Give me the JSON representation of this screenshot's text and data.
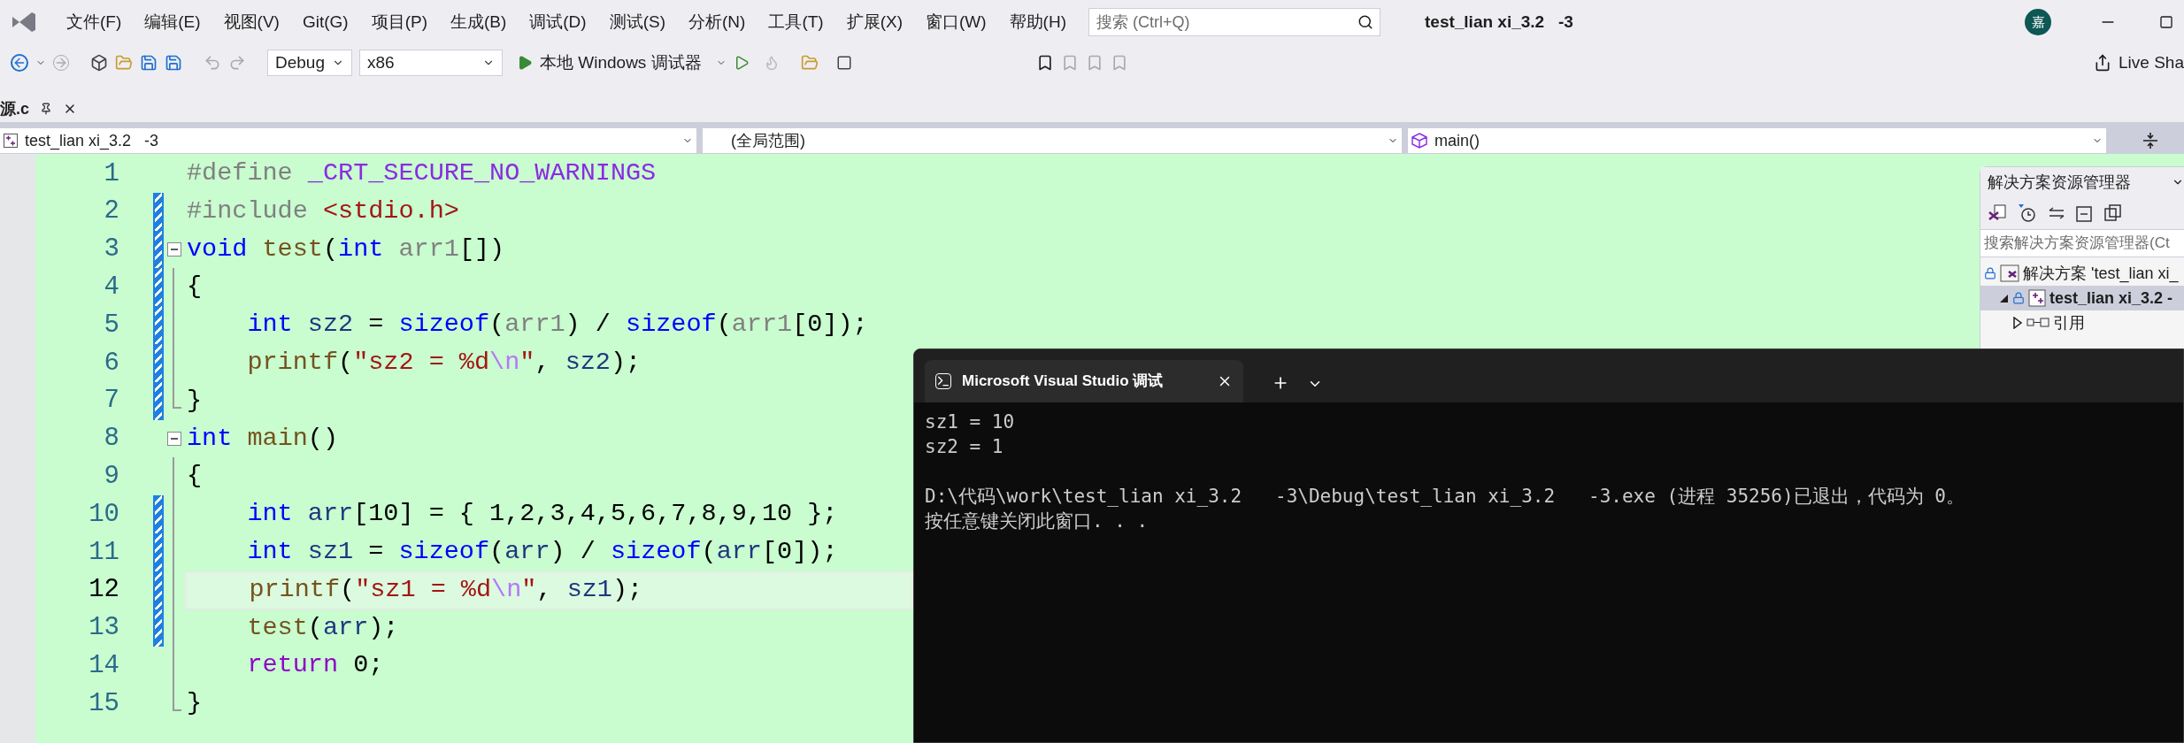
{
  "menu": [
    "文件(F)",
    "编辑(E)",
    "视图(V)",
    "Git(G)",
    "项目(P)",
    "生成(B)",
    "调试(D)",
    "测试(S)",
    "分析(N)",
    "工具(T)",
    "扩展(X)",
    "窗口(W)",
    "帮助(H)"
  ],
  "search": {
    "placeholder": "搜索 (Ctrl+Q)"
  },
  "window": {
    "title": "test_lian xi_3.2   -3",
    "avatar": "嘉"
  },
  "toolbar": {
    "configuration": "Debug",
    "platform": "x86",
    "run": "本地 Windows 调试器",
    "live_share": "Live Sha"
  },
  "document_tab": {
    "title": "源.c",
    "selected": true
  },
  "navigation": {
    "project": "test_lian xi_3.2   -3",
    "scope": "(全局范围)",
    "member": "main()"
  },
  "code": [
    {
      "number": "1",
      "changed": false,
      "current": false,
      "fold": false,
      "in_block": false,
      "block_end": false,
      "tokens": [
        {
          "kind": "pp",
          "text": "#define "
        },
        {
          "kind": "macro",
          "text": "_CRT_SECURE_NO_WARNINGS"
        }
      ]
    },
    {
      "number": "2",
      "changed": true,
      "current": false,
      "fold": false,
      "in_block": false,
      "block_end": false,
      "tokens": [
        {
          "kind": "pp",
          "text": "#include "
        },
        {
          "kind": "str",
          "text": "<stdio.h>"
        }
      ]
    },
    {
      "number": "3",
      "changed": true,
      "current": false,
      "fold": true,
      "in_block": false,
      "block_end": false,
      "tokens": [
        {
          "kind": "kw",
          "text": "void "
        },
        {
          "kind": "fn",
          "text": "test"
        },
        {
          "kind": "plain",
          "text": "("
        },
        {
          "kind": "kw",
          "text": "int "
        },
        {
          "kind": "param",
          "text": "arr1"
        },
        {
          "kind": "plain",
          "text": "[])"
        }
      ]
    },
    {
      "number": "4",
      "changed": true,
      "current": false,
      "fold": false,
      "in_block": true,
      "block_end": false,
      "tokens": [
        {
          "kind": "plain",
          "text": "{"
        }
      ]
    },
    {
      "number": "5",
      "changed": true,
      "current": false,
      "fold": false,
      "in_block": true,
      "block_end": false,
      "tokens": [
        {
          "kind": "kw",
          "text": "    int "
        },
        {
          "kind": "var",
          "text": "sz2"
        },
        {
          "kind": "plain",
          "text": " = "
        },
        {
          "kind": "kw",
          "text": "sizeof"
        },
        {
          "kind": "plain",
          "text": "("
        },
        {
          "kind": "param",
          "text": "arr1"
        },
        {
          "kind": "plain",
          "text": ") / "
        },
        {
          "kind": "kw",
          "text": "sizeof"
        },
        {
          "kind": "plain",
          "text": "("
        },
        {
          "kind": "param",
          "text": "arr1"
        },
        {
          "kind": "plain",
          "text": "[0]);"
        }
      ]
    },
    {
      "number": "6",
      "changed": true,
      "current": false,
      "fold": false,
      "in_block": true,
      "block_end": false,
      "tokens": [
        {
          "kind": "fn",
          "text": "    printf"
        },
        {
          "kind": "plain",
          "text": "("
        },
        {
          "kind": "str",
          "text": "\"sz2 = %d"
        },
        {
          "kind": "esc",
          "text": "\\n"
        },
        {
          "kind": "str",
          "text": "\""
        },
        {
          "kind": "plain",
          "text": ", "
        },
        {
          "kind": "var",
          "text": "sz2"
        },
        {
          "kind": "plain",
          "text": ");"
        }
      ]
    },
    {
      "number": "7",
      "changed": true,
      "current": false,
      "fold": false,
      "in_block": true,
      "block_end": true,
      "tokens": [
        {
          "kind": "plain",
          "text": "}"
        }
      ]
    },
    {
      "number": "8",
      "changed": false,
      "current": false,
      "fold": true,
      "in_block": false,
      "block_end": false,
      "tokens": [
        {
          "kind": "kw",
          "text": "int "
        },
        {
          "kind": "fn",
          "text": "main"
        },
        {
          "kind": "plain",
          "text": "()"
        }
      ]
    },
    {
      "number": "9",
      "changed": false,
      "current": false,
      "fold": false,
      "in_block": true,
      "block_end": false,
      "tokens": [
        {
          "kind": "plain",
          "text": "{"
        }
      ]
    },
    {
      "number": "10",
      "changed": true,
      "current": false,
      "fold": false,
      "in_block": true,
      "block_end": false,
      "tokens": [
        {
          "kind": "kw",
          "text": "    int "
        },
        {
          "kind": "var",
          "text": "arr"
        },
        {
          "kind": "plain",
          "text": "[10] = { 1,2,3,4,5,6,7,8,9,10 };"
        }
      ]
    },
    {
      "number": "11",
      "changed": true,
      "current": false,
      "fold": false,
      "in_block": true,
      "block_end": false,
      "tokens": [
        {
          "kind": "kw",
          "text": "    int "
        },
        {
          "kind": "var",
          "text": "sz1"
        },
        {
          "kind": "plain",
          "text": " = "
        },
        {
          "kind": "kw",
          "text": "sizeof"
        },
        {
          "kind": "plain",
          "text": "("
        },
        {
          "kind": "var",
          "text": "arr"
        },
        {
          "kind": "plain",
          "text": ") / "
        },
        {
          "kind": "kw",
          "text": "sizeof"
        },
        {
          "kind": "plain",
          "text": "("
        },
        {
          "kind": "var",
          "text": "arr"
        },
        {
          "kind": "plain",
          "text": "[0]);"
        }
      ]
    },
    {
      "number": "12",
      "changed": true,
      "current": true,
      "fold": false,
      "in_block": true,
      "block_end": false,
      "tokens": [
        {
          "kind": "fn",
          "text": "    printf"
        },
        {
          "kind": "plain",
          "text": "("
        },
        {
          "kind": "str",
          "text": "\"sz1 = %d"
        },
        {
          "kind": "esc",
          "text": "\\n"
        },
        {
          "kind": "str",
          "text": "\""
        },
        {
          "kind": "plain",
          "text": ", "
        },
        {
          "kind": "var",
          "text": "sz1"
        },
        {
          "kind": "plain",
          "text": ");"
        }
      ]
    },
    {
      "number": "13",
      "changed": true,
      "current": false,
      "fold": false,
      "in_block": true,
      "block_end": false,
      "tokens": [
        {
          "kind": "fn",
          "text": "    test"
        },
        {
          "kind": "plain",
          "text": "("
        },
        {
          "kind": "var",
          "text": "arr"
        },
        {
          "kind": "plain",
          "text": ");"
        }
      ]
    },
    {
      "number": "14",
      "changed": false,
      "current": false,
      "fold": false,
      "in_block": true,
      "block_end": false,
      "tokens": [
        {
          "kind": "ctl",
          "text": "    return"
        },
        {
          "kind": "plain",
          "text": " 0;"
        }
      ]
    },
    {
      "number": "15",
      "changed": false,
      "current": false,
      "fold": false,
      "in_block": true,
      "block_end": true,
      "tokens": [
        {
          "kind": "plain",
          "text": "}"
        }
      ]
    }
  ],
  "solution_explorer": {
    "title": "解决方案资源管理器",
    "search_placeholder": "搜索解决方案资源管理器(Ct",
    "tree": [
      {
        "label": "解决方案 'test_lian xi_",
        "kind": "solution",
        "selected": false,
        "children": [
          {
            "label": "test_lian xi_3.2   -",
            "kind": "project",
            "selected": true,
            "expanded": true,
            "children": [
              {
                "label": "引用",
                "kind": "references",
                "selected": false,
                "expanded": false
              }
            ]
          }
        ]
      }
    ]
  },
  "console": {
    "tab_title": "Microsoft Visual Studio 调试",
    "blocks": [
      [
        "sz1 = 10",
        "sz2 = 1"
      ],
      [
        "D:\\代码\\work\\test_lian xi_3.2   -3\\Debug\\test_lian xi_3.2   -3.exe (进程 35256)已退出，代码为 0。",
        "按任意键关闭此窗口. . ."
      ]
    ]
  }
}
